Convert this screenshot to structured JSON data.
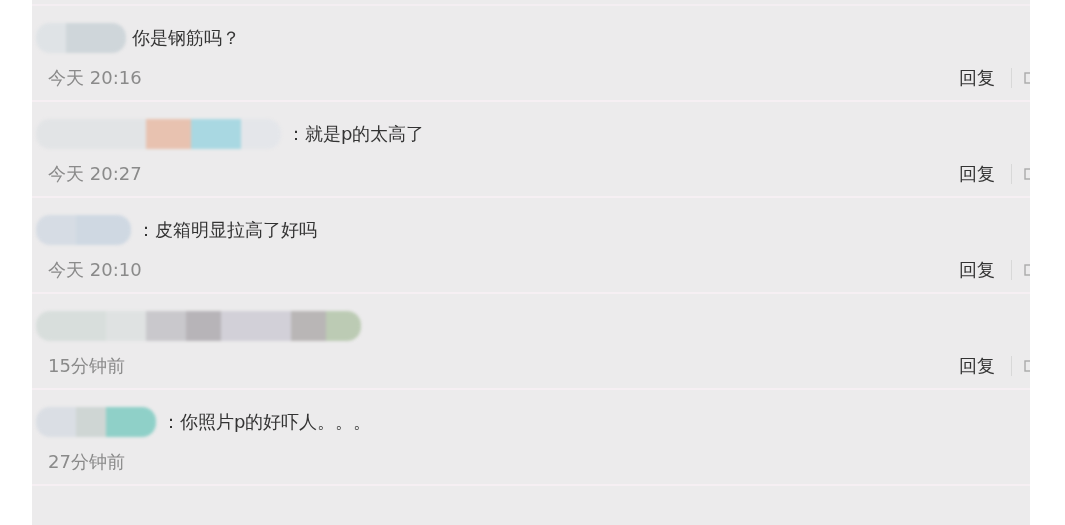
{
  "comments": [
    {
      "text": "你是钢筋吗？",
      "time": "今天 20:16",
      "reply": "回复"
    },
    {
      "text": "：就是p的太高了",
      "time": "今天 20:27",
      "reply": "回复"
    },
    {
      "text": "：皮箱明显拉高了好吗",
      "time": "今天 20:10",
      "reply": "回复"
    },
    {
      "time": "15分钟前",
      "reply": "回复"
    },
    {
      "text": "：你照片p的好吓人。。。",
      "time": "27分钟前"
    }
  ]
}
